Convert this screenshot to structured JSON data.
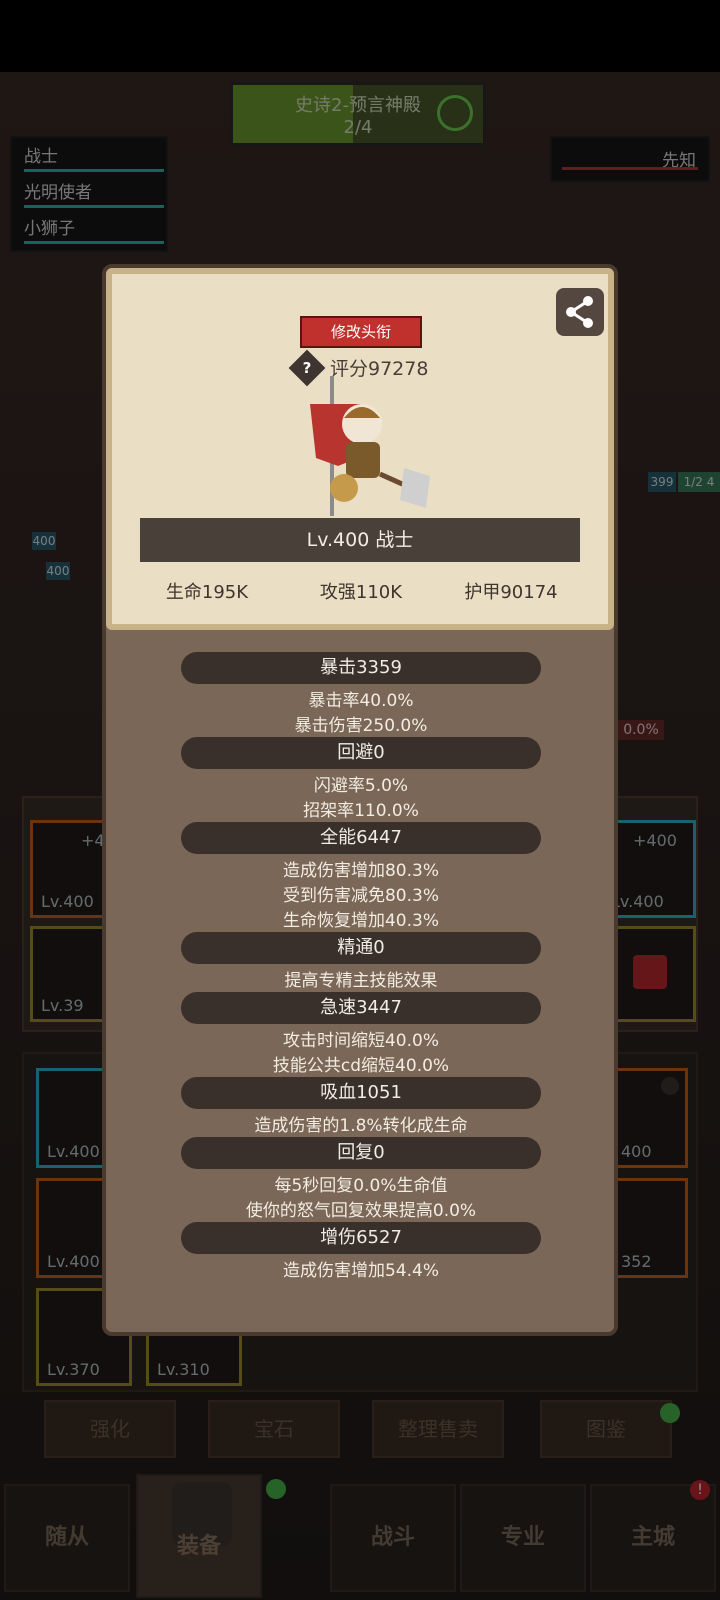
{
  "stage": {
    "title": "史诗2-预言神殿",
    "progress_text": "2/4",
    "progress": 0.48
  },
  "party": [
    {
      "name": "战士"
    },
    {
      "name": "光明使者"
    },
    {
      "name": "小狮子"
    }
  ],
  "enemy": {
    "name": "先知"
  },
  "background_hud": {
    "ally_levels": [
      "400",
      "400"
    ],
    "enemy_level": "399",
    "enemy_value": "1/2 4",
    "pct": "0.0%"
  },
  "equipment_slots": [
    {
      "level": "Lv.400",
      "plus": "+4"
    },
    {
      "level": "Lv.400",
      "plus": "+400"
    },
    {
      "level": "Lv.39"
    },
    {
      "level": "Lv.400"
    },
    {
      "level": "400"
    },
    {
      "level": "Lv.400"
    },
    {
      "level": "352"
    },
    {
      "level": "Lv.370"
    },
    {
      "level": "Lv.310"
    }
  ],
  "bottom_buttons": [
    "强化",
    "宝石",
    "整理售卖",
    "图鉴"
  ],
  "tabs": [
    "随从",
    "装备",
    "战斗",
    "专业",
    "主城"
  ],
  "dialog": {
    "rename_label": "修改头衔",
    "score": "评分97278",
    "help_glyph": "?",
    "level_line": "Lv.400 战士",
    "card_stats": [
      "生命195K",
      "攻强110K",
      "护甲90174"
    ],
    "sections": [
      {
        "header": "暴击3359",
        "lines": [
          "暴击率40.0%",
          "暴击伤害250.0%"
        ]
      },
      {
        "header": "回避0",
        "lines": [
          "闪避率5.0%",
          "招架率110.0%"
        ]
      },
      {
        "header": "全能6447",
        "lines": [
          "造成伤害增加80.3%",
          "受到伤害减免80.3%",
          "生命恢复增加40.3%"
        ]
      },
      {
        "header": "精通0",
        "lines": [
          "提高专精主技能效果"
        ]
      },
      {
        "header": "急速3447",
        "lines": [
          "攻击时间缩短40.0%",
          "技能公共cd缩短40.0%"
        ]
      },
      {
        "header": "吸血1051",
        "lines": [
          "造成伤害的1.8%转化成生命"
        ]
      },
      {
        "header": "回复0",
        "lines": [
          "每5秒回复0.0%生命值",
          "使你的怒气回复效果提高0.0%"
        ]
      },
      {
        "header": "增伤6527",
        "lines": [
          "造成伤害增加54.4%"
        ]
      }
    ]
  },
  "colors": {
    "accent_red": "#c0302c",
    "badge_green": "#48b54a",
    "slot_blue": "#2bb3c8",
    "slot_orange": "#c2601d"
  }
}
